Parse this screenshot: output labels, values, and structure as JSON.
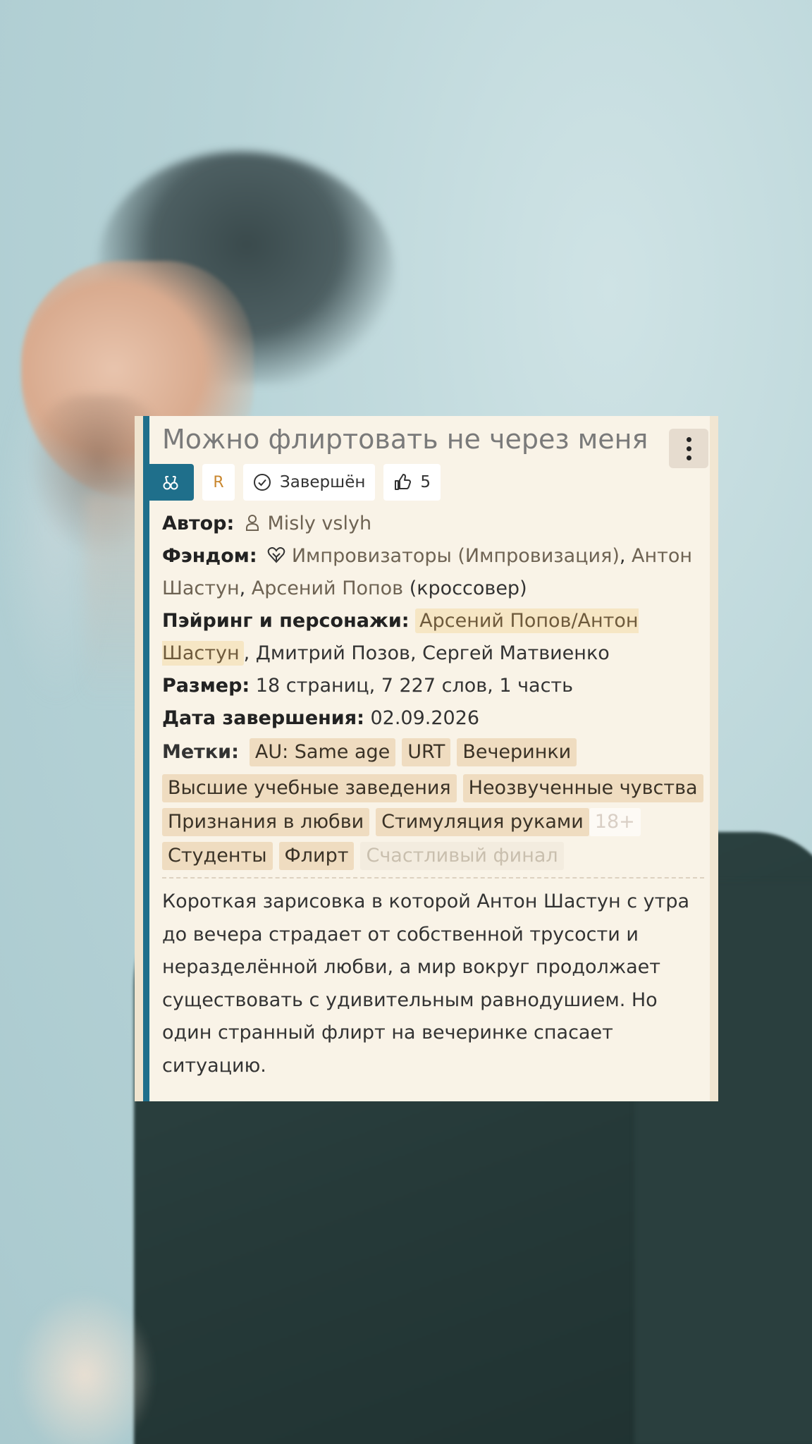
{
  "work": {
    "title": "Можно флиртовать не через меня",
    "rating": "R",
    "status": "Завершён",
    "likes": "5",
    "author_label": "Автор:",
    "author": "Misly vslyh",
    "fandom_label": "Фэндом:",
    "fandoms": [
      "Импровизаторы (Импровизация)",
      "Антон Шастун",
      "Арсений Попов"
    ],
    "fandom_suffix": "(кроссовер)",
    "pairing_label": "Пэйринг и персонажи:",
    "pairing_main": "Арсений Попов/Антон Шастун",
    "characters": ", Дмитрий Позов, Сергей Матвиенко",
    "size_label": "Размер:",
    "size": "18 страниц, 7 227 слов, 1 часть",
    "date_label": "Дата завершения:",
    "date": "02.09.2026",
    "tags_label": "Метки:",
    "tags": [
      "AU: Same age",
      "URT",
      "Вечеринки",
      "Высшие учебные заведения",
      "Неозвученные чувства",
      "Признания в любви",
      "Стимуляция руками"
    ],
    "tag_adult": "18+",
    "tags_more": [
      "Студенты",
      "Флирт"
    ],
    "tag_faded": "Счастливый финал",
    "description": "Короткая зарисовка в которой Антон Шастун с утра до вечера страдает от собственной трусости и неразделённой любви, а мир вокруг продолжает существовать с удивительным равнодушием. Но один странный флирт на вечеринке спасает ситуацию."
  },
  "icons": {
    "direction": "slash-direction-icon",
    "status": "check-circle-icon",
    "likes": "thumbs-up-icon",
    "author": "user-icon",
    "fandom": "heart-crossover-icon",
    "menu": "kebab-menu-icon"
  },
  "colors": {
    "accent": "#1f6f8b",
    "card_bg": "#f9f3e7",
    "tag_bg": "#efdcc0",
    "pairing_bg": "#f6e6c4",
    "rating": "#c9872f"
  }
}
